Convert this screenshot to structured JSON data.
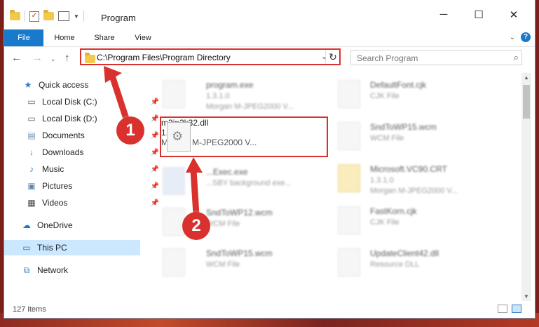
{
  "window": {
    "title": "Program"
  },
  "ribbon": {
    "tabs": [
      "File",
      "Home",
      "Share",
      "View"
    ]
  },
  "address": {
    "path": "C:\\Program Files\\Program Directory"
  },
  "search": {
    "placeholder": "Search Program"
  },
  "sidebar": {
    "items": [
      {
        "label": "Quick access",
        "icon": "star-icon"
      },
      {
        "label": "Local Disk (C:)",
        "icon": "drive-icon",
        "pinned": true
      },
      {
        "label": "Local Disk (D:)",
        "icon": "drive-icon",
        "pinned": true
      },
      {
        "label": "Documents",
        "icon": "document-icon",
        "pinned": true
      },
      {
        "label": "Downloads",
        "icon": "download-icon",
        "pinned": true
      },
      {
        "label": "Music",
        "icon": "music-icon",
        "pinned": true
      },
      {
        "label": "Pictures",
        "icon": "picture-icon",
        "pinned": true
      },
      {
        "label": "Videos",
        "icon": "video-icon",
        "pinned": true
      },
      {
        "label": "OneDrive",
        "icon": "cloud-icon"
      },
      {
        "label": "This PC",
        "icon": "computer-icon",
        "selected": true
      },
      {
        "label": "Network",
        "icon": "network-icon"
      }
    ]
  },
  "files": {
    "left": [
      {
        "name": "program.exe",
        "line1": "1.3.1.0",
        "line2": "Morgan M-JPEG2000 V..."
      },
      {
        "name": "m3jp2k32.dll",
        "line1": "1.3.1.0",
        "line2": "Morgan M-JPEG2000 V..."
      },
      {
        "name": "...Exec.exe",
        "line1": "...SBY background exe...",
        "line2": ""
      },
      {
        "name": "SndToWP12.wcm",
        "line1": "WCM File",
        "line2": ""
      },
      {
        "name": "SndToWP15.wcm",
        "line1": "WCM File",
        "line2": ""
      }
    ],
    "right": [
      {
        "name": "DefaultFont.cjk",
        "line1": "CJK File",
        "line2": ""
      },
      {
        "name": "SndToWP15.wcm",
        "line1": "WCM File",
        "line2": ""
      },
      {
        "name": "Microsoft.VC90.CRT",
        "line1": "1.3.1.0",
        "line2": "Morgan M-JPEG2000 V..."
      },
      {
        "name": "FastKorn.cjk",
        "line1": "CJK File",
        "line2": ""
      },
      {
        "name": "UpdateClient42.dll",
        "line1": "Resource DLL",
        "line2": ""
      }
    ]
  },
  "status": {
    "items_count": "127 items"
  },
  "callouts": [
    "1",
    "2"
  ],
  "colors": {
    "accent": "#1979ca",
    "highlight": "#d9322e",
    "selected_bg": "#cce8ff"
  }
}
